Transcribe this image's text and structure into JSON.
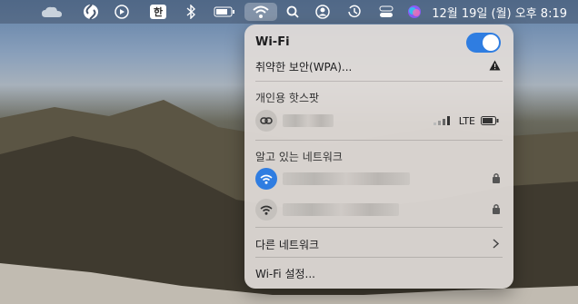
{
  "menubar": {
    "icons": [
      "cloud-icon",
      "shazam-icon",
      "play-icon",
      "input-source-icon",
      "bluetooth-icon",
      "battery-icon",
      "wifi-icon",
      "search-icon",
      "user-icon",
      "time-machine-icon",
      "control-center-icon",
      "siri-icon"
    ],
    "input_source_label": "한",
    "clock": "12월 19일 (월) 오후 8:19"
  },
  "wifi_menu": {
    "title": "Wi-Fi",
    "toggle_on": true,
    "warning_text": "취약한 보안(WPA)...",
    "hotspot_section": "개인용 핫스팟",
    "hotspot_network": {
      "lte_label": "LTE"
    },
    "known_section": "알고 있는 네트워크",
    "other_networks": "다른 네트워크",
    "settings": "Wi-Fi 설정..."
  },
  "colors": {
    "accent": "#2f7de1",
    "panel": "#e1dcd8"
  }
}
